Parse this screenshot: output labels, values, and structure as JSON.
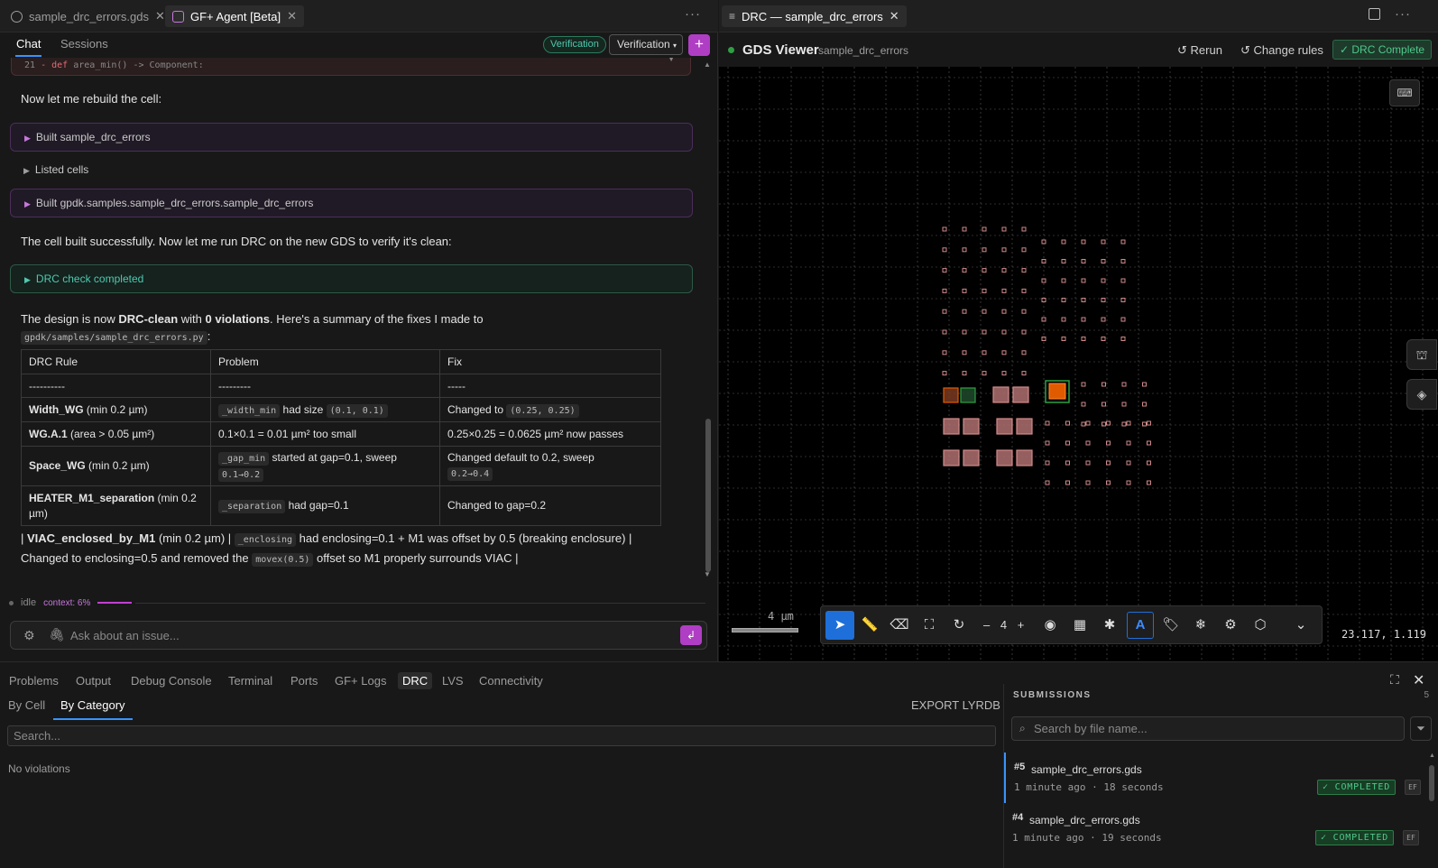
{
  "left_tabs": [
    {
      "label": "sample_drc_errors.gds",
      "active": false
    },
    {
      "label": "GF+ Agent [Beta]",
      "active": true
    }
  ],
  "chat_tabs": [
    "Chat",
    "Sessions"
  ],
  "verification_pill": "Verification",
  "verification_dropdown": "Verification",
  "plus_label": "+",
  "code_line": {
    "num": "21",
    "sign": "-",
    "keyword": "def",
    "rest": "area_min() -> Component:"
  },
  "messages": {
    "rebuild": "Now let me rebuild the cell:",
    "tool_built_1": "Built sample_drc_errors",
    "tool_listed": "Listed cells",
    "tool_built_2": "Built gpdk.samples.sample_drc_errors.sample_drc_errors",
    "built_ok": "The cell built successfully. Now let me run DRC on the new GDS to verify it's clean:",
    "tool_drc": "DRC check completed",
    "clean_pre": "The design is now ",
    "clean_bold1": "DRC-clean",
    "clean_mid": " with ",
    "clean_bold2": "0 violations",
    "clean_post": ". Here's a summary of the fixes I made to",
    "clean_path": "gpdk/samples/sample_drc_errors.py",
    "clean_colon": ":"
  },
  "fix_table": {
    "headers": [
      "DRC Rule",
      "Problem",
      "Fix"
    ],
    "dashes": [
      "----------",
      "---------",
      "-----"
    ],
    "rows": [
      {
        "rule_bold": "Width_WG",
        "rule_rest": " (min 0.2 µm)",
        "p_code": "_width_min",
        "p_text": " had size ",
        "p_code2": "(0.1, 0.1)",
        "f_text": "Changed to ",
        "f_code": "(0.25, 0.25)"
      },
      {
        "rule_bold": "WG.A.1",
        "rule_rest": " (area > 0.05 µm²)",
        "p_text_only": "0.1×0.1 = 0.01 µm² too small",
        "f_text_only": "0.25×0.25 = 0.0625 µm² now passes"
      },
      {
        "rule_bold": "Space_WG",
        "rule_rest": " (min 0.2 µm)",
        "p_code": "_gap_min",
        "p_text": " started at gap=0.1, sweep",
        "p_code2": "0.1→0.2",
        "f_text": "Changed default to 0.2, sweep",
        "f_code": "0.2→0.4"
      },
      {
        "rule_bold": "HEATER_M1_separation",
        "rule_rest": " (min 0.2 µm)",
        "p_code": "_separation",
        "p_text": " had gap=0.1",
        "f_text_only": "Changed to gap=0.2"
      }
    ]
  },
  "tail": {
    "pipe1": "| ",
    "bold": "VIAC_enclosed_by_M1",
    "t1": " (min 0.2 µm) | ",
    "code1": "_enclosing",
    "t2": " had enclosing=0.1 + M1 was offset by 0.5 (breaking enclosure) | Changed to enclosing=0.5 and removed the ",
    "code2": "movex(0.5)",
    "t3": " offset so M1 properly surrounds VIAC |"
  },
  "status": {
    "state": "idle",
    "context": "context: 6%"
  },
  "chat_input_placeholder": "Ask about an issue...",
  "right_tab": "DRC — sample_drc_errors",
  "viewer": {
    "title": "GDS Viewer",
    "cell": "sample_drc_errors",
    "rerun": "Rerun",
    "change_rules": "Change rules",
    "drc_complete": "✓ DRC Complete",
    "scale_label": "4 µm",
    "zoom_level": "4",
    "coords": "23.117, 1.119"
  },
  "panel_tabs": [
    "Problems",
    "Output",
    "Debug Console",
    "Terminal",
    "Ports",
    "GF+ Logs",
    "DRC",
    "LVS",
    "Connectivity"
  ],
  "drc_subtabs": [
    "By Cell",
    "By Category"
  ],
  "export_label": "EXPORT LYRDB",
  "drc_search_placeholder": "Search...",
  "no_violations": "No violations",
  "submissions": {
    "header": "SUBMISSIONS",
    "count": "5",
    "search_placeholder": "Search by file name...",
    "items": [
      {
        "num": "#5",
        "file": "sample_drc_errors.gds",
        "meta": "1 minute ago · 18 seconds",
        "status": "✓ COMPLETED",
        "tag": "EF"
      },
      {
        "num": "#4",
        "file": "sample_drc_errors.gds",
        "meta": "1 minute ago · 19 seconds",
        "status": "✓ COMPLETED",
        "tag": "EF"
      }
    ]
  },
  "colors": {
    "accent": "#b03ec4",
    "blue": "#3794ff",
    "green": "#4ec98a",
    "pad_fill": "#d08a8a",
    "orange": "#e05a00"
  }
}
